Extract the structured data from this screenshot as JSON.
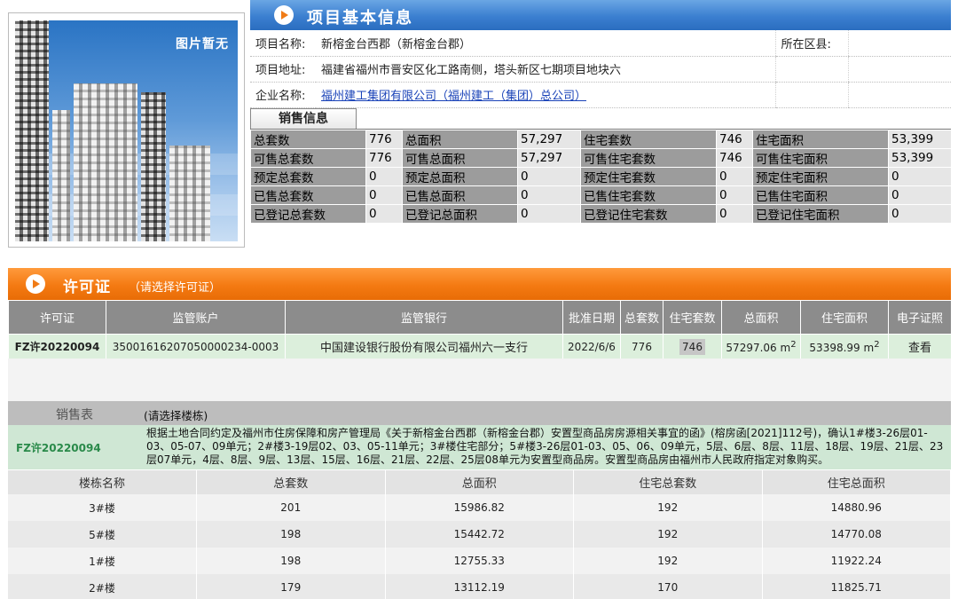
{
  "photo": {
    "placeholder_text": "图片暂无"
  },
  "project_header": {
    "title": "项目基本信息"
  },
  "project": {
    "name_label": "项目名称:",
    "name": "新榕金台西郡（新榕金台郡）",
    "district_label": "所在区县:",
    "district": "",
    "address_label": "项目地址:",
    "address": "福建省福州市晋安区化工路南侧，塔头新区七期项目地块六",
    "company_label": "企业名称:",
    "company": "福州建工集团有限公司（福州建工（集团）总公司）"
  },
  "sales_info": {
    "tab_label": "销售信息",
    "rows": [
      [
        {
          "k": "总套数",
          "v": "776"
        },
        {
          "k": "总面积",
          "v": "57,297"
        },
        {
          "k": "住宅套数",
          "v": "746"
        },
        {
          "k": "住宅面积",
          "v": "53,399"
        }
      ],
      [
        {
          "k": "可售总套数",
          "v": "776"
        },
        {
          "k": "可售总面积",
          "v": "57,297"
        },
        {
          "k": "可售住宅套数",
          "v": "746"
        },
        {
          "k": "可售住宅面积",
          "v": "53,399"
        }
      ],
      [
        {
          "k": "预定总套数",
          "v": "0"
        },
        {
          "k": "预定总面积",
          "v": "0"
        },
        {
          "k": "预定住宅套数",
          "v": "0"
        },
        {
          "k": "预定住宅面积",
          "v": "0"
        }
      ],
      [
        {
          "k": "已售总套数",
          "v": "0"
        },
        {
          "k": "已售总面积",
          "v": "0"
        },
        {
          "k": "已售住宅套数",
          "v": "0"
        },
        {
          "k": "已售住宅面积",
          "v": "0"
        }
      ],
      [
        {
          "k": "已登记总套数",
          "v": "0"
        },
        {
          "k": "已登记总面积",
          "v": "0"
        },
        {
          "k": "已登记住宅套数",
          "v": "0"
        },
        {
          "k": "已登记住宅面积",
          "v": "0"
        }
      ]
    ]
  },
  "permit_header": {
    "title": "许可证",
    "subtitle": "（请选择许可证）"
  },
  "permit_table": {
    "headers": [
      "许可证",
      "监管账户",
      "监管银行",
      "批准日期",
      "总套数",
      "住宅套数",
      "总面积",
      "住宅面积",
      "电子证照"
    ],
    "row": {
      "permit_no": "FZ许20220094",
      "account": "35001616207050000234-0003",
      "bank": "中国建设银行股份有限公司福州六一支行",
      "date": "2022/6/6",
      "total_units": "776",
      "res_units": "746",
      "total_area": "57297.06 m",
      "res_area": "53398.99 m",
      "area_sup": "2",
      "cert_link": "查看"
    }
  },
  "sales_table": {
    "title": "销售表",
    "subtitle": "(请选择楼栋)",
    "permit_no": "FZ许20220094",
    "note": "根据土地合同约定及福州市住房保障和房产管理局《关于新榕金台西郡（新榕金台郡）安置型商品房房源相关事宜的函》(榕房函[2021]112号)，确认1#楼3-26层01-03、05-07、09单元；2#楼3-19层02、03、05-11单元；3#楼住宅部分；5#楼3-26层01-03、05、06、09单元，5层、6层、8层、11层、18层、19层、21层、23层07单元，4层、8层、9层、13层、15层、16层、21层、22层、25层08单元为安置型商品房。安置型商品房由福州市人民政府指定对象购买。",
    "headers": [
      "楼栋名称",
      "总套数",
      "总面积",
      "住宅总套数",
      "住宅总面积"
    ],
    "rows": [
      [
        "3#楼",
        "201",
        "15986.82",
        "192",
        "14880.96"
      ],
      [
        "5#楼",
        "198",
        "15442.72",
        "192",
        "14770.08"
      ],
      [
        "1#楼",
        "198",
        "12755.33",
        "192",
        "11922.24"
      ],
      [
        "2#楼",
        "179",
        "13112.19",
        "170",
        "11825.71"
      ]
    ]
  }
}
